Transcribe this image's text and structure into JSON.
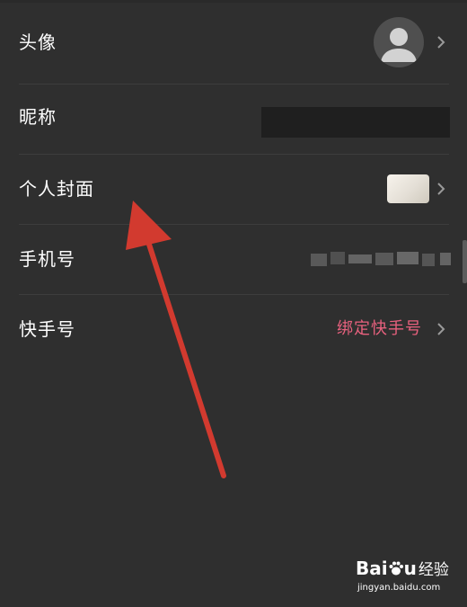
{
  "profile_settings": {
    "rows": [
      {
        "label": "头像"
      },
      {
        "label": "昵称"
      },
      {
        "label": "个人封面"
      },
      {
        "label": "手机号"
      },
      {
        "label": "快手号",
        "action_text": "绑定快手号"
      }
    ]
  },
  "watermark": {
    "logo_latin_1": "Bai",
    "logo_latin_2": "u",
    "logo_cn": "经验",
    "url": "jingyan.baidu.com"
  },
  "colors": {
    "background": "#2f2f2f",
    "accent_link": "#e8617e",
    "arrow": "#d23a2f"
  },
  "icons": [
    "avatar-placeholder-icon",
    "chevron-right-icon",
    "baidu-paw-icon"
  ]
}
